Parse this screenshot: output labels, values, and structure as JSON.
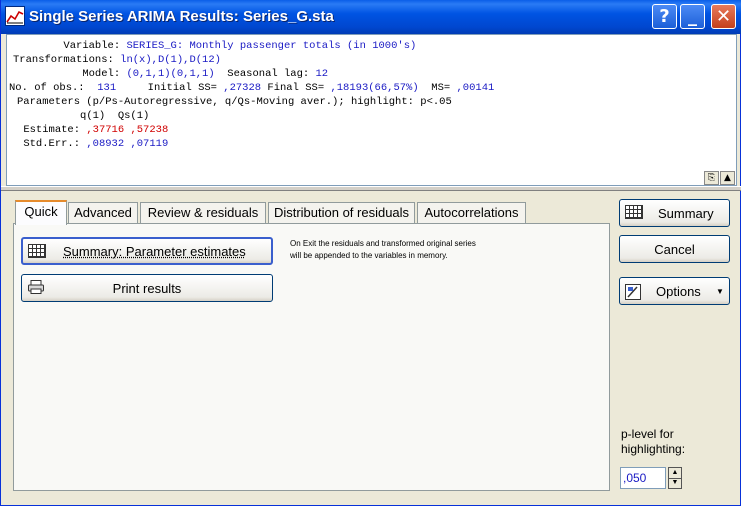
{
  "window": {
    "title": "Single Series ARIMA Results: Series_G.sta",
    "help_glyph": "?",
    "minimize_glyph": "_",
    "close_glyph": "✕"
  },
  "output": {
    "variable_label": "Variable:",
    "variable_value": "SERIES_G: Monthly passenger totals (in 1000's)",
    "transformations_label": "Transformations:",
    "transformations_value": "ln(x),D(1),D(12)",
    "model_label": "Model:",
    "model_value": "(0,1,1)(0,1,1)",
    "seasonal_lag_label": "Seasonal lag:",
    "seasonal_lag_value": "12",
    "nobs_label": "No. of obs.:",
    "nobs_value": "131",
    "initial_ss_label": "Initial SS=",
    "initial_ss_value": ",27328",
    "final_ss_label": "Final SS=",
    "final_ss_value": ",18193(66,57%)",
    "ms_label": "MS=",
    "ms_value": ",00141",
    "parameters_line": "Parameters (p/Ps-Autoregressive, q/Qs-Moving aver.); highlight: p<.05",
    "col_headers": "q(1)  Qs(1)",
    "estimate_label": "Estimate:",
    "estimate_values": ",37716 ,57238",
    "stderr_label": "Std.Err.:",
    "stderr_values": ",08932 ,07119",
    "copy_glyph": "⎘",
    "up_glyph": "▲"
  },
  "tabs": [
    {
      "label": "Quick",
      "active": true
    },
    {
      "label": "Advanced",
      "active": false
    },
    {
      "label": "Review & residuals",
      "active": false
    },
    {
      "label": "Distribution of residuals",
      "active": false
    },
    {
      "label": "Autocorrelations",
      "active": false
    }
  ],
  "quick": {
    "summary_button": "Summary: Parameter estimates",
    "print_button": "Print results",
    "note_line1": "On Exit the residuals and transformed original series",
    "note_line2": "will be appended to the variables in memory."
  },
  "side": {
    "summary": "Summary",
    "cancel": "Cancel",
    "options": "Options",
    "plevel_label": "p-level for highlighting:",
    "plevel_value": ",050"
  },
  "icons": [
    "chart-icon",
    "spreadsheet-icon",
    "printer-icon",
    "options-icon",
    "copy-icon",
    "arrow-up-icon",
    "help-icon",
    "minimize-icon",
    "close-icon"
  ],
  "colors": {
    "title_bar": "#0054e3",
    "value_blue": "#1a1ac4",
    "value_red": "#d00000",
    "tab_highlight": "#e68b2c"
  }
}
